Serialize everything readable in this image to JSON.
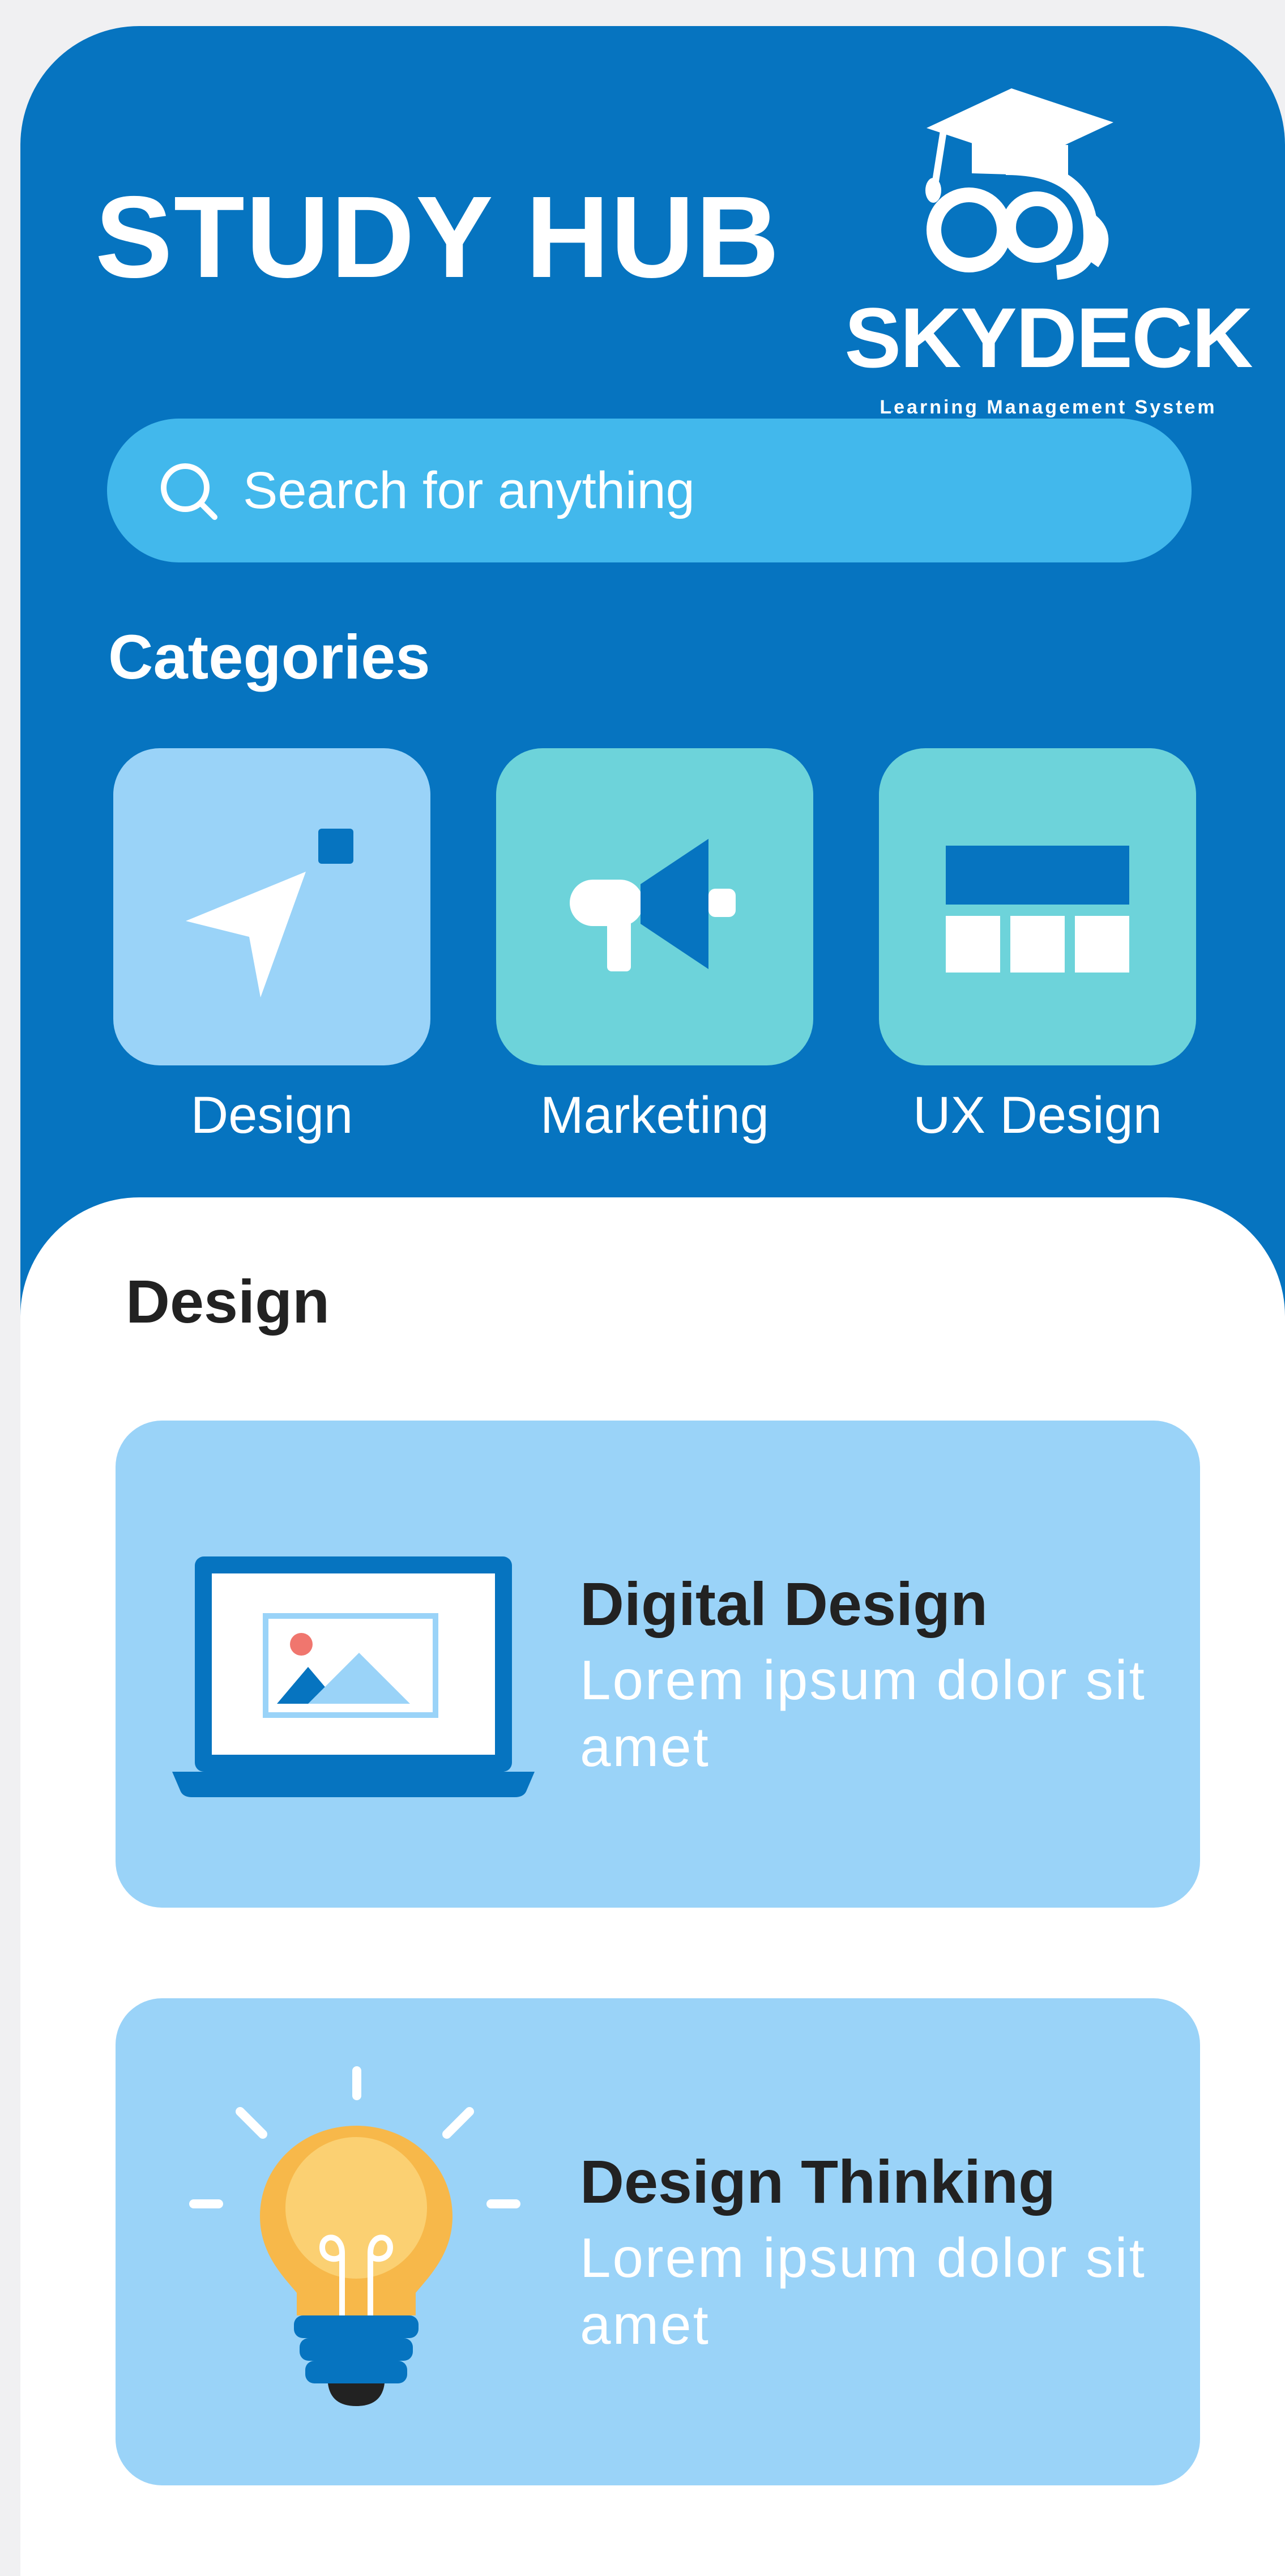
{
  "header": {
    "title": "STUDY HUB",
    "logo_name": "SKYDECK",
    "logo_tagline": "Learning Management System"
  },
  "search": {
    "placeholder": "Search for anything",
    "icon": "search-icon"
  },
  "categories": {
    "heading": "Categories",
    "items": [
      {
        "label": "Design",
        "icon": "cursor-arrow-icon",
        "color": "#9ad3f8"
      },
      {
        "label": "Marketing",
        "icon": "megaphone-icon",
        "color": "#6dd3da"
      },
      {
        "label": "UX Design",
        "icon": "layout-grid-icon",
        "color": "#6dd3da"
      }
    ]
  },
  "section": {
    "title": "Design",
    "cards": [
      {
        "title": "Digital Design",
        "description": "Lorem ipsum dolor sit amet",
        "icon": "laptop-image-icon"
      },
      {
        "title": "Design Thinking",
        "description": "Lorem ipsum dolor sit amet",
        "icon": "light-bulb-icon"
      }
    ]
  },
  "colors": {
    "primary": "#0674c0",
    "search_bg": "#42b8ec",
    "card_bg": "#9ad3f8",
    "tile_teal": "#6dd3da",
    "text_dark": "#222222"
  }
}
